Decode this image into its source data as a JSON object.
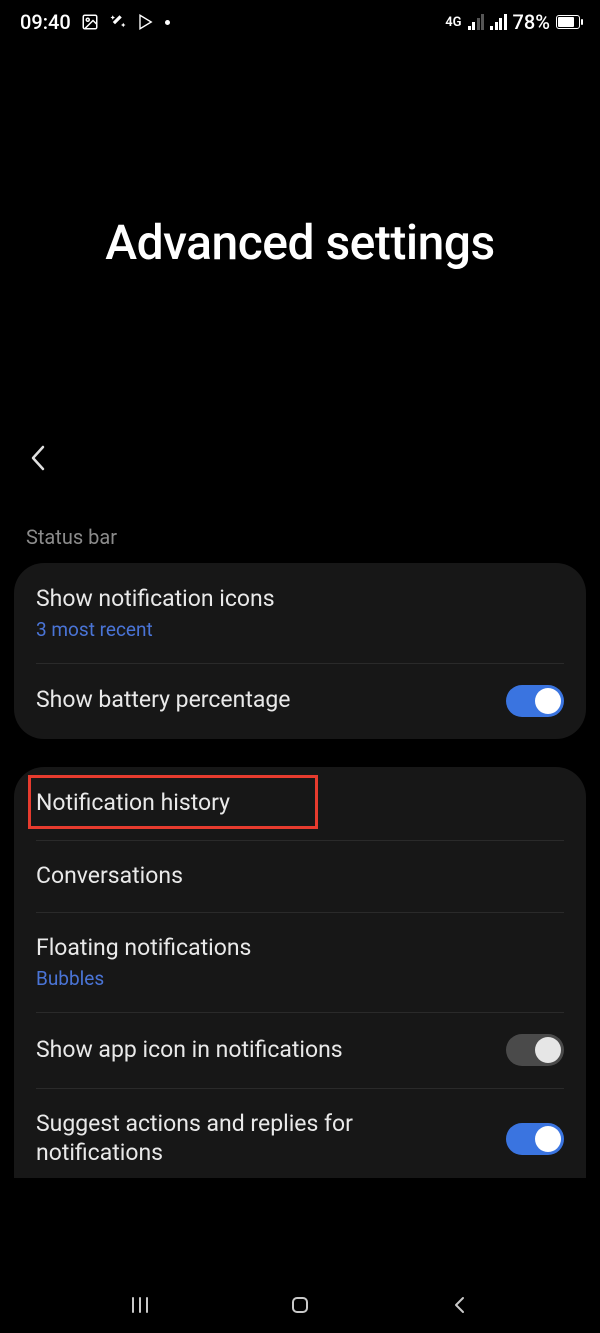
{
  "status": {
    "time": "09:40",
    "network_label": "4G",
    "battery_text": "78%",
    "battery_fill_pct": 78
  },
  "header": {
    "title": "Advanced settings"
  },
  "section1": {
    "label": "Status bar",
    "items": [
      {
        "title": "Show notification icons",
        "sub": "3 most recent",
        "toggle": null
      },
      {
        "title": "Show battery percentage",
        "sub": null,
        "toggle": true
      }
    ]
  },
  "section2": {
    "items": [
      {
        "title": "Notification history",
        "sub": null,
        "toggle": null,
        "highlighted": true
      },
      {
        "title": "Conversations",
        "sub": null,
        "toggle": null
      },
      {
        "title": "Floating notifications",
        "sub": "Bubbles",
        "toggle": null
      },
      {
        "title": "Show app icon in notifications",
        "sub": null,
        "toggle": false
      },
      {
        "title": "Suggest actions and replies for notifications",
        "sub": null,
        "toggle": true
      }
    ]
  },
  "colors": {
    "accent": "#3a74e0",
    "link": "#4a74d6",
    "highlight_border": "#e63b2e"
  }
}
